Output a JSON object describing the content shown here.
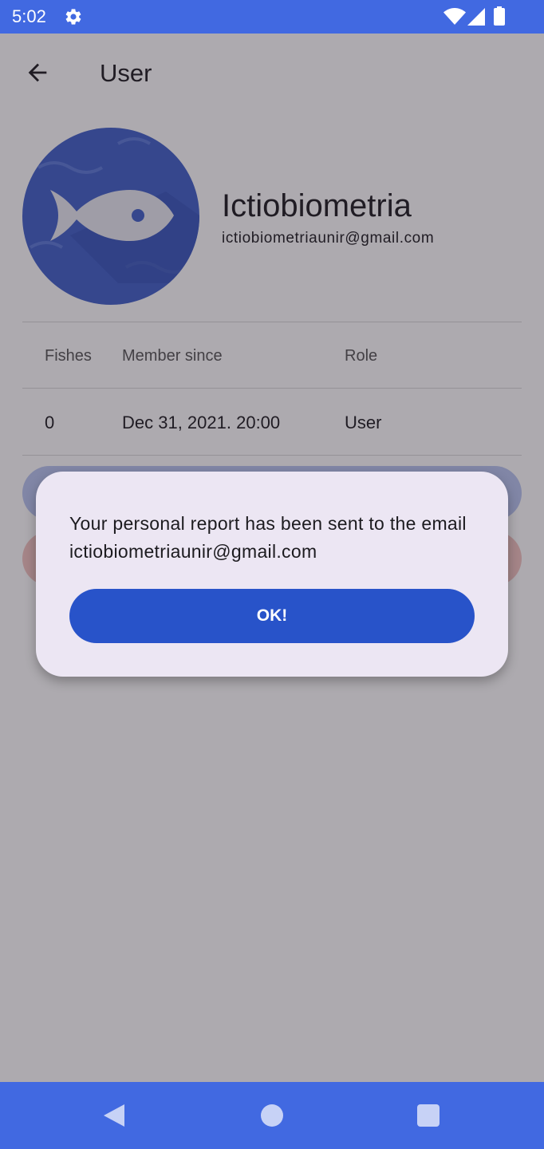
{
  "status_bar": {
    "time": "5:02",
    "icons": [
      "gear-icon",
      "wifi-icon",
      "signal-icon",
      "battery-icon"
    ]
  },
  "app_bar": {
    "title": "User",
    "back_icon": "arrow-back-icon"
  },
  "profile": {
    "avatar_icon": "fish-icon",
    "name": "Ictiobiometria",
    "email": "ictiobiometriaunir@gmail.com"
  },
  "stats_table": {
    "headers": [
      "Fishes",
      "Member since",
      "Role"
    ],
    "row": [
      "0",
      "Dec 31, 2021. 20:00",
      "User"
    ]
  },
  "dialog": {
    "message": "Your personal report has been sent to the email ictiobiometriaunir@gmail.com",
    "ok_label": "OK!"
  },
  "nav_bar": {
    "icons": [
      "nav-back-icon",
      "nav-home-icon",
      "nav-recents-icon"
    ]
  },
  "colors": {
    "status_bar": "#4169e1",
    "nav_bar": "#4169e1",
    "avatar_bg": "#3f60c9",
    "dialog_bg": "#ece6f3",
    "ok_button": "#2853c9"
  }
}
